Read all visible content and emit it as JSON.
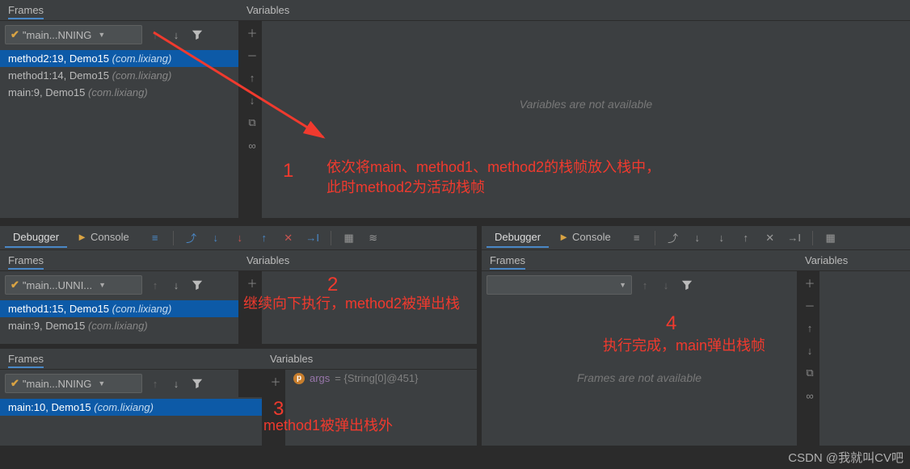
{
  "labels": {
    "frames": "Frames",
    "variables": "Variables",
    "debugger": "Debugger",
    "console": "Console"
  },
  "panel1": {
    "thread": "\"main...NNING",
    "frames": [
      {
        "call": "method2:19, Demo15",
        "pkg": "(com.lixiang)"
      },
      {
        "call": "method1:14, Demo15",
        "pkg": "(com.lixiang)"
      },
      {
        "call": "main:9, Demo15",
        "pkg": "(com.lixiang)"
      }
    ],
    "vars_msg": "Variables are not available"
  },
  "panel2": {
    "thread": "\"main...UNNI...",
    "frames": [
      {
        "call": "method1:15, Demo15",
        "pkg": "(com.lixiang)"
      },
      {
        "call": "main:9, Demo15",
        "pkg": "(com.lixiang)"
      }
    ]
  },
  "panel3": {
    "thread": "\"main...NNING",
    "frames": [
      {
        "call": "main:10, Demo15",
        "pkg": "(com.lixiang)"
      }
    ],
    "var_name": "args",
    "var_value": "= {String[0]@451}"
  },
  "panel4": {
    "frames_msg": "Frames are not available"
  },
  "annotations": {
    "a1_num": "1",
    "a1_text": "依次将main、method1、method2的栈帧放入栈中，\n此时method2为活动栈帧",
    "a2_num": "2",
    "a2_text": "继续向下执行，method2被弹出栈",
    "a3_num": "3",
    "a3_text": "method1被弹出栈外",
    "a4_num": "4",
    "a4_text": "执行完成，main弹出栈帧"
  },
  "watermark": "CSDN @我就叫CV吧"
}
